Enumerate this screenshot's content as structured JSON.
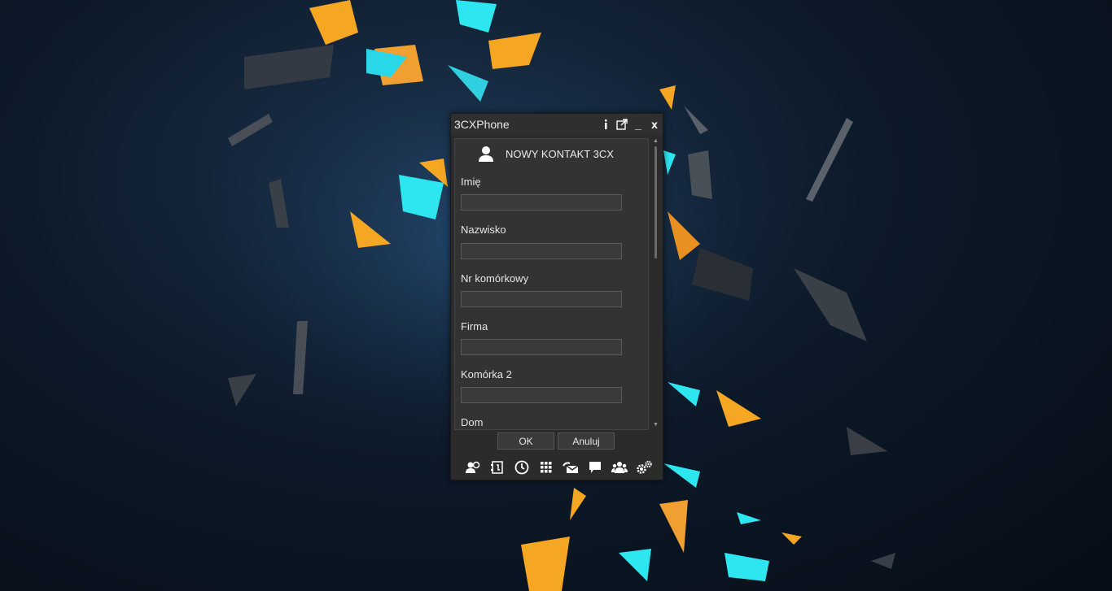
{
  "window": {
    "title": "3CXPhone",
    "info_icon": "info-icon",
    "popout_icon": "popout-icon",
    "minimize_label": "_",
    "close_label": "x"
  },
  "form": {
    "heading": "NOWY KONTAKT 3CX",
    "heading_icon": "person-icon",
    "fields": [
      {
        "label": "Imię",
        "value": ""
      },
      {
        "label": "Nazwisko",
        "value": ""
      },
      {
        "label": "Nr komórkowy",
        "value": ""
      },
      {
        "label": "Firma",
        "value": ""
      },
      {
        "label": "Komórka 2",
        "value": ""
      },
      {
        "label": "Dom",
        "value": ""
      }
    ]
  },
  "buttons": {
    "ok": "OK",
    "cancel": "Anuluj"
  },
  "toolbar": {
    "icons": [
      "presence-icon",
      "contacts-icon",
      "history-icon",
      "dialpad-icon",
      "voicemail-icon",
      "chat-icon",
      "conference-icon",
      "settings-icon"
    ]
  },
  "colors": {
    "window_bg": "#2b2b2b",
    "content_bg": "#333333",
    "accent_orange": "#f5a623",
    "accent_cyan": "#2ee6f0"
  }
}
